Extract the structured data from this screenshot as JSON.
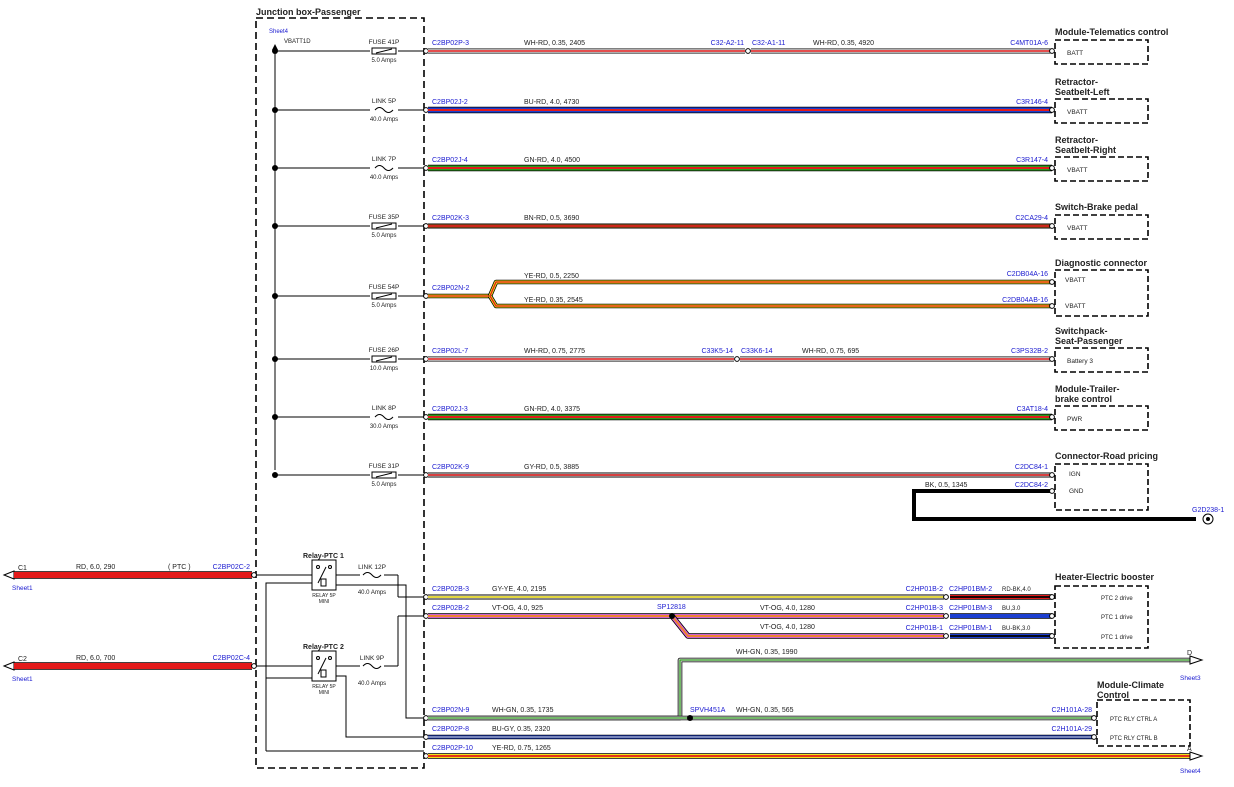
{
  "junction_box": {
    "title": "Junction box-Passenger",
    "sheet_label": "Sheet4",
    "supply_label": "VBATT1D"
  },
  "circuits": [
    {
      "fuse": "FUSE 41P",
      "amps": "5.0 Amps",
      "connector": "C2BP02P-3",
      "wire": "WH-RD, 0.35, 2405",
      "colors": [
        "#e8e8e8",
        "#e31b1b"
      ],
      "inline_left": "C32-A2-11",
      "inline_right": "C32-A1-11",
      "wire2": "WH-RD, 0.35, 4920",
      "module_connector": "C4MT01A-6",
      "module_title": [
        "Module-Telematics control"
      ],
      "pin": "BATT"
    },
    {
      "fuse": "LINK 5P",
      "amps": "40.0 Amps",
      "connector": "C2BP02J-2",
      "wire": "BU-RD, 4.0, 4730",
      "colors": [
        "#1c3fd0",
        "#e31b1b"
      ],
      "module_connector": "C3R146-4",
      "module_title": [
        "Retractor-",
        "Seatbelt-Left"
      ],
      "pin": "VBATT"
    },
    {
      "fuse": "LINK 7P",
      "amps": "40.0 Amps",
      "connector": "C2BP02J-4",
      "wire": "GN-RD, 4.0, 4500",
      "colors": [
        "#2e9a1e",
        "#e31b1b"
      ],
      "module_connector": "C3R147-4",
      "module_title": [
        "Retractor-",
        "Seatbelt-Right"
      ],
      "pin": "VBATT"
    },
    {
      "fuse": "FUSE 35P",
      "amps": "5.0 Amps",
      "connector": "C2BP02K-3",
      "wire": "BN-RD, 0.5, 3690",
      "colors": [
        "#8a4a1a",
        "#e31b1b"
      ],
      "module_connector": "C2CA29-4",
      "module_title": [
        "Switch-Brake pedal"
      ],
      "pin": "VBATT"
    },
    {
      "fuse": "FUSE 54P",
      "amps": "5.0 Amps",
      "connector": "C2BP02N-2",
      "wire": "YE-RD, 0.5, 2250",
      "colors": [
        "#f2e21a",
        "#e31b1b"
      ],
      "wire_b": "YE-RD, 0.35, 2545",
      "module_connector": "C2DB04A-16",
      "module_connector_b": "C2DB04AB-16",
      "module_title": [
        "Diagnostic connector"
      ],
      "pin": "VBATT",
      "pin_b": "VBATT"
    },
    {
      "fuse": "FUSE 26P",
      "amps": "10.0 Amps",
      "connector": "C2BP02L-7",
      "wire": "WH-RD, 0.75, 2775",
      "colors": [
        "#e8e8e8",
        "#e31b1b"
      ],
      "inline_left": "C33K5-14",
      "inline_right": "C33K6-14",
      "wire2": "WH-RD, 0.75, 695",
      "module_connector": "C3PS32B-2",
      "module_title": [
        "Switchpack-",
        "Seat-Passenger"
      ],
      "pin": "Battery 3"
    },
    {
      "fuse": "LINK 8P",
      "amps": "30.0 Amps",
      "connector": "C2BP02J-3",
      "wire": "GN-RD, 4.0, 3375",
      "colors": [
        "#2e9a1e",
        "#e31b1b"
      ],
      "module_connector": "C3AT18-4",
      "module_title": [
        "Module-Trailer-",
        "brake control"
      ],
      "pin": "PWR"
    },
    {
      "fuse": "FUSE 31P",
      "amps": "5.0 Amps",
      "connector": "C2BP02K-9",
      "wire": "GY-RD, 0.5, 3885",
      "colors": [
        "#b0b0b0",
        "#e31b1b"
      ],
      "module_connector": "C2DC84-1",
      "module_title": [
        "Connector-Road pricing"
      ],
      "pin": "IGN",
      "pin_b": "GND",
      "gnd_connector": "C2DC84-2",
      "gnd_wire": "BK, 0.5, 1345",
      "ground_ref": "G2D238-1"
    }
  ],
  "inputs": [
    {
      "ref": "C1",
      "sheet": "Sheet1",
      "wire": "RD, 6.0, 290",
      "tag": "( PTC )",
      "connector": "C2BP02C-2"
    },
    {
      "ref": "C2",
      "sheet": "Sheet1",
      "wire": "RD, 6.0, 700",
      "connector": "C2BP02C-4"
    }
  ],
  "relays": [
    {
      "title": "Relay-PTC 1",
      "sub": [
        "RELAY 5P",
        "MINI"
      ],
      "link": "LINK 12P",
      "amps": "40.0 Amps"
    },
    {
      "title": "Relay-PTC 2",
      "sub": [
        "RELAY 5P",
        "MINI"
      ],
      "link": "LINK 9P",
      "amps": "40.0 Amps"
    }
  ],
  "heater": {
    "title": "Heater-Electric booster",
    "lines": [
      {
        "connector": "C2BP02B-3",
        "wire": "GY-YE, 4.0, 2195",
        "inline_left": "C2HP01B-2",
        "inline_right": "C2HP01BM-2",
        "wire2": "RD-BK,4.0",
        "pin": "PTC 2 drive",
        "colors": [
          "#b0b0b0",
          "#f2e21a"
        ]
      },
      {
        "connector": "C2BP02B-2",
        "wire": "VT-OG, 4.0, 925",
        "splice": "SP12818",
        "wire_mid": "VT-OG, 4.0, 1280",
        "inline_left": "C2HP01B-3",
        "inline_right": "C2HP01BM-3",
        "wire2": "BU,3.0",
        "pin": "PTC 1 drive",
        "colors": [
          "#d060d0",
          "#f08a1a"
        ]
      },
      {
        "wire_mid": "VT-OG, 4.0, 1280",
        "inline_left": "C2HP01B-1",
        "inline_right": "C2HP01BM-1",
        "wire2": "BU-BK,3.0",
        "pin": "PTC 1 drive"
      }
    ]
  },
  "climate": {
    "title": [
      "Module-Climate",
      "Control"
    ],
    "offsheet_d": {
      "wire": "WH-GN, 0.35, 1990",
      "ref": "D",
      "sheet": "Sheet3"
    },
    "lines": [
      {
        "connector": "C2BP02N-9",
        "wire": "WH-GN, 0.35, 1735",
        "splice": "SPVH451A",
        "wire2": "WH-GN, 0.35, 565",
        "module_connector": "C2H101A-28",
        "pin": "PTC RLY CTRL A",
        "colors": [
          "#e8e8e8",
          "#2e9a1e"
        ]
      },
      {
        "connector": "C2BP02P-8",
        "wire": "BU-GY, 0.35, 2320",
        "module_connector": "C2H101A-29",
        "pin": "PTC RLY CTRL B",
        "colors": [
          "#1c3fd0",
          "#b0b0b0"
        ]
      }
    ]
  },
  "offsheet_a": {
    "connector": "C2BP02P-10",
    "wire": "YE-RD, 0.75, 1265",
    "ref": "A",
    "sheet": "Sheet4",
    "colors": [
      "#f2e21a",
      "#e31b1b"
    ]
  }
}
